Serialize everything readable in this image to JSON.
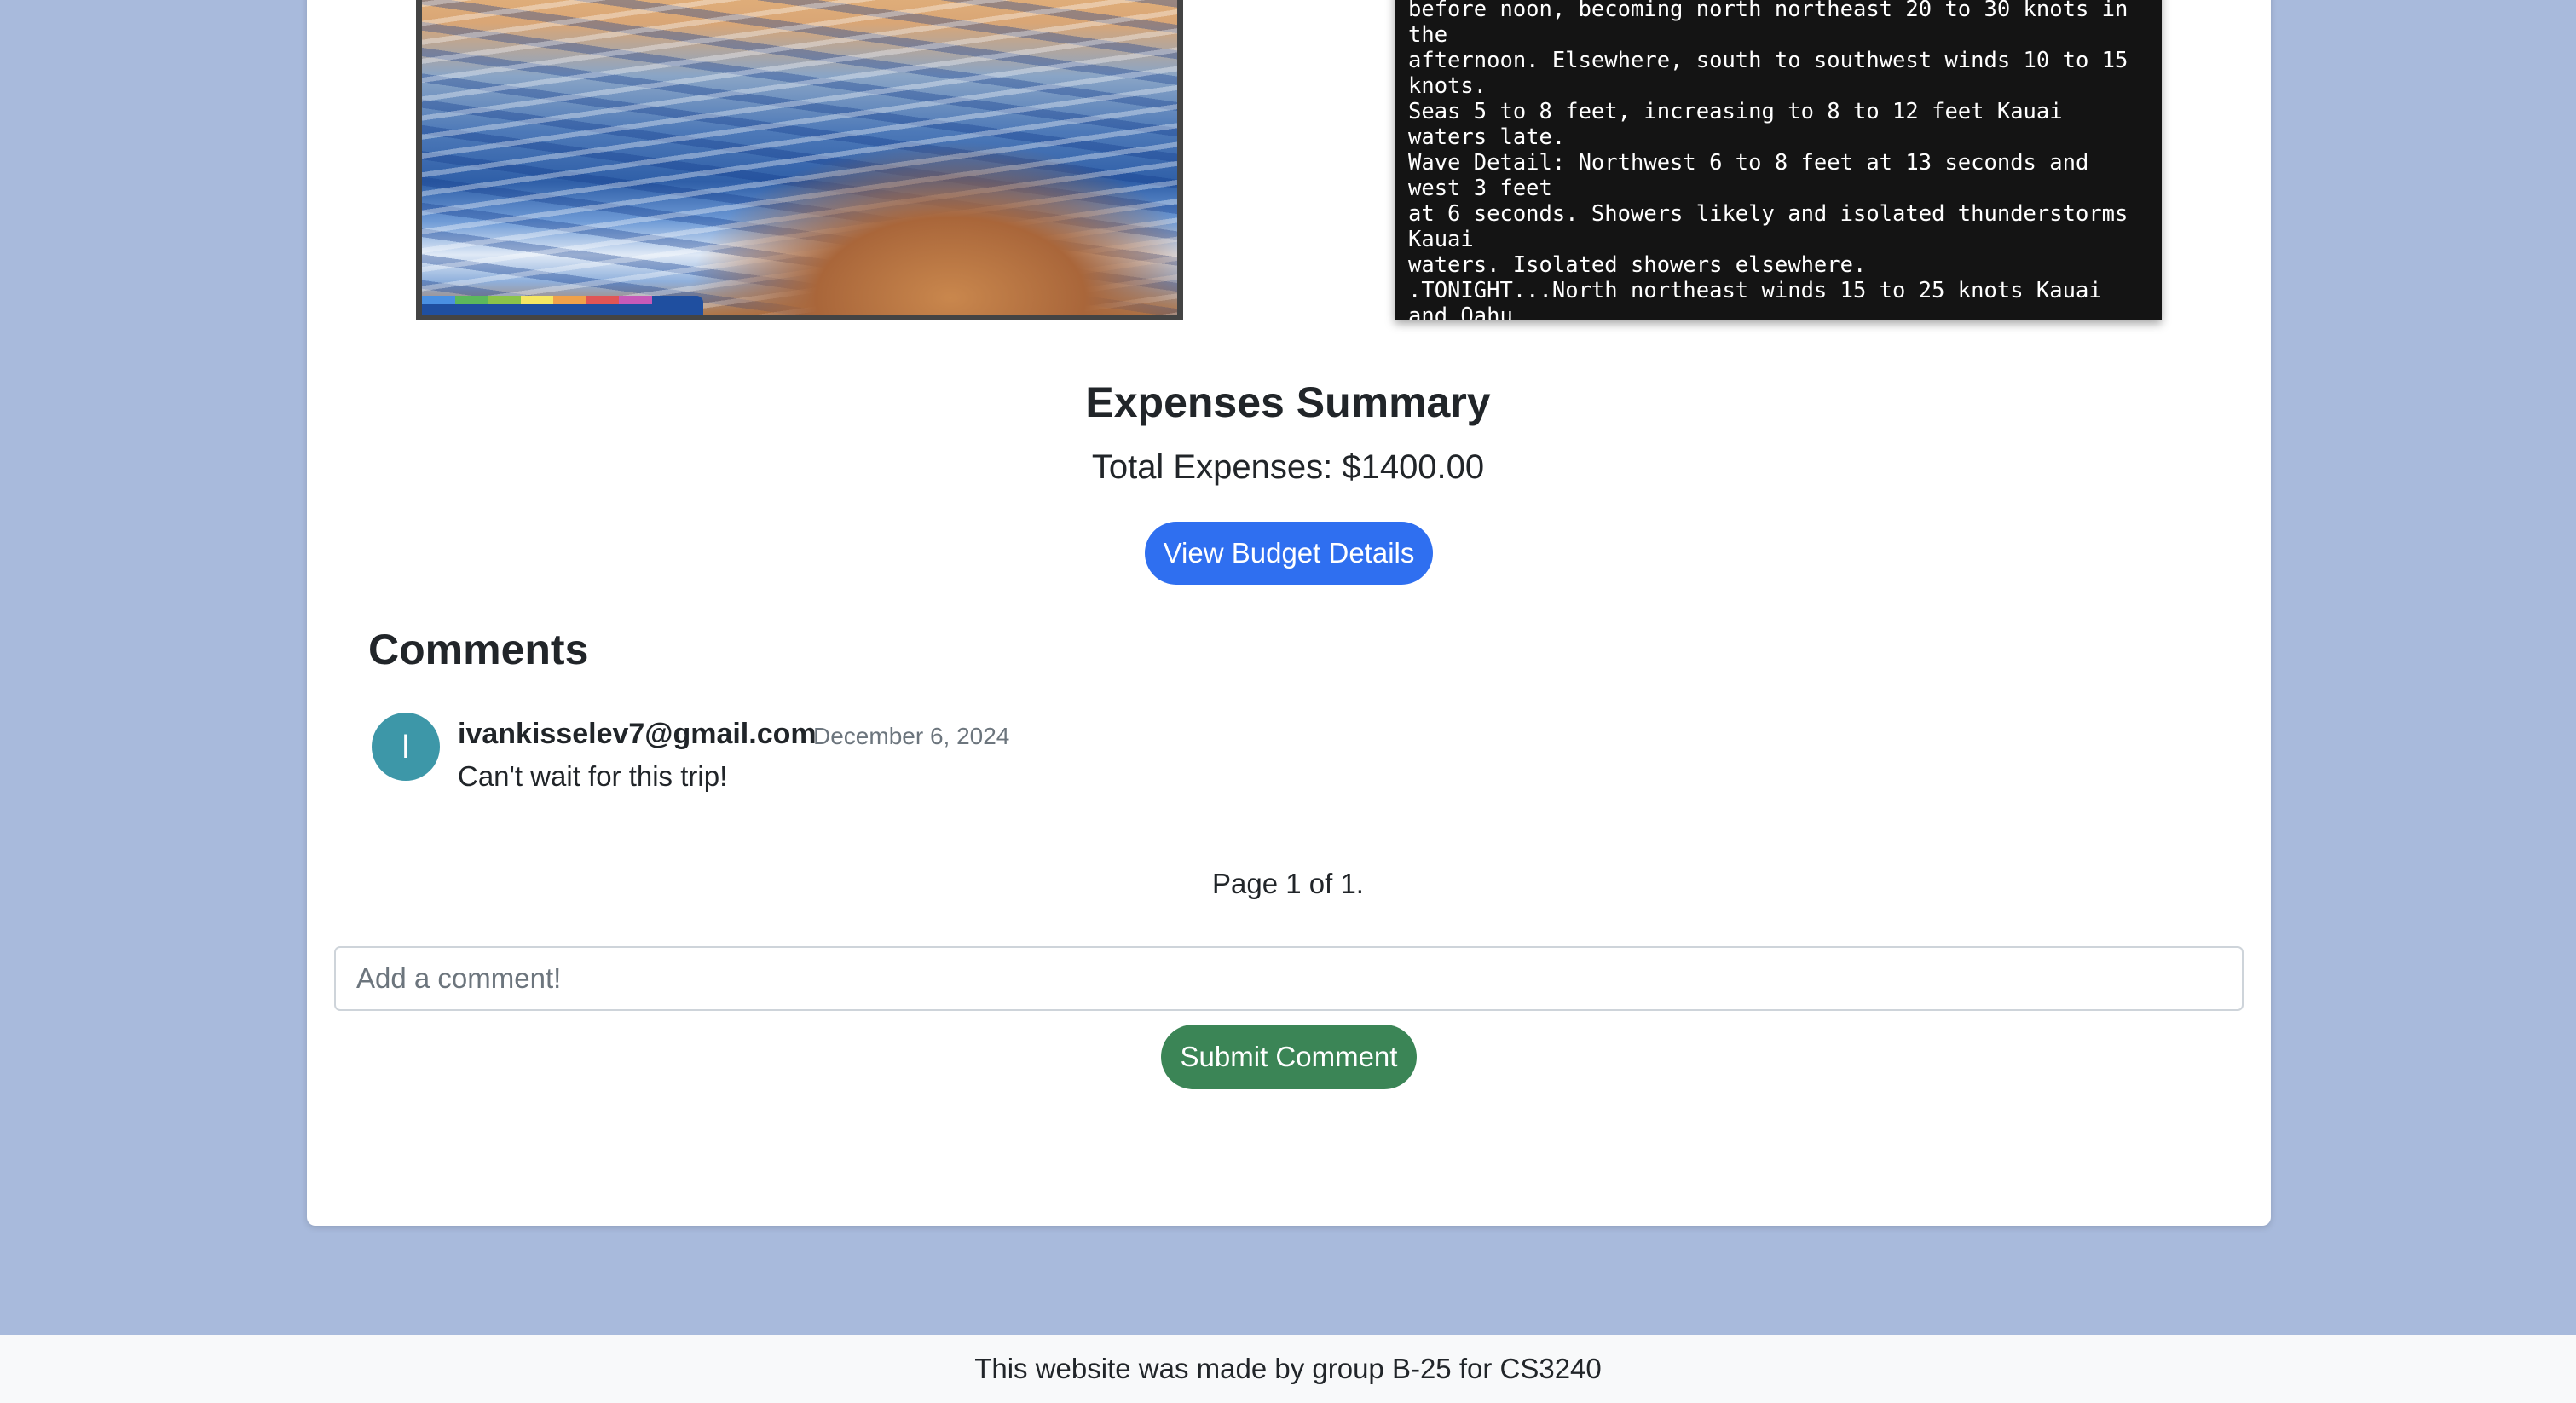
{
  "weather": {
    "text": "before noon, becoming north northeast 20 to 30 knots in\nthe\nafternoon. Elsewhere, south to southwest winds 10 to 15\nknots.\nSeas 5 to 8 feet, increasing to 8 to 12 feet Kauai\nwaters late.\nWave Detail: Northwest 6 to 8 feet at 13 seconds and\nwest 3 feet\nat 6 seconds. Showers likely and isolated thunderstorms\nKauai\nwaters. Isolated showers elsewhere.\n.TONIGHT...North northeast winds 15 to 25 knots Kauai\nand Oahu"
  },
  "image": {
    "stripe_colors": [
      "#4a90e2",
      "#5cb85c",
      "#8bc34a",
      "#f5e663",
      "#f0a14a",
      "#e05555",
      "#c75ab8"
    ]
  },
  "expenses": {
    "title": "Expenses Summary",
    "total": "Total Expenses: $1400.00",
    "button_label": "View Budget Details"
  },
  "comments": {
    "heading": "Comments",
    "items": [
      {
        "avatar_letter": "I",
        "user": "ivankisselev7@gmail.com",
        "date": "December 6, 2024",
        "text": "Can't wait for this trip!"
      }
    ],
    "pagination": "Page 1 of 1.",
    "input_placeholder": "Add a comment!",
    "submit_label": "Submit Comment"
  },
  "footer": {
    "text": "This website was made by group B-25 for CS3240"
  },
  "colors": {
    "page_background": "#a8badc",
    "primary_button": "#2f6ff0",
    "submit_button": "#3b8556",
    "avatar": "#3d97a8"
  }
}
